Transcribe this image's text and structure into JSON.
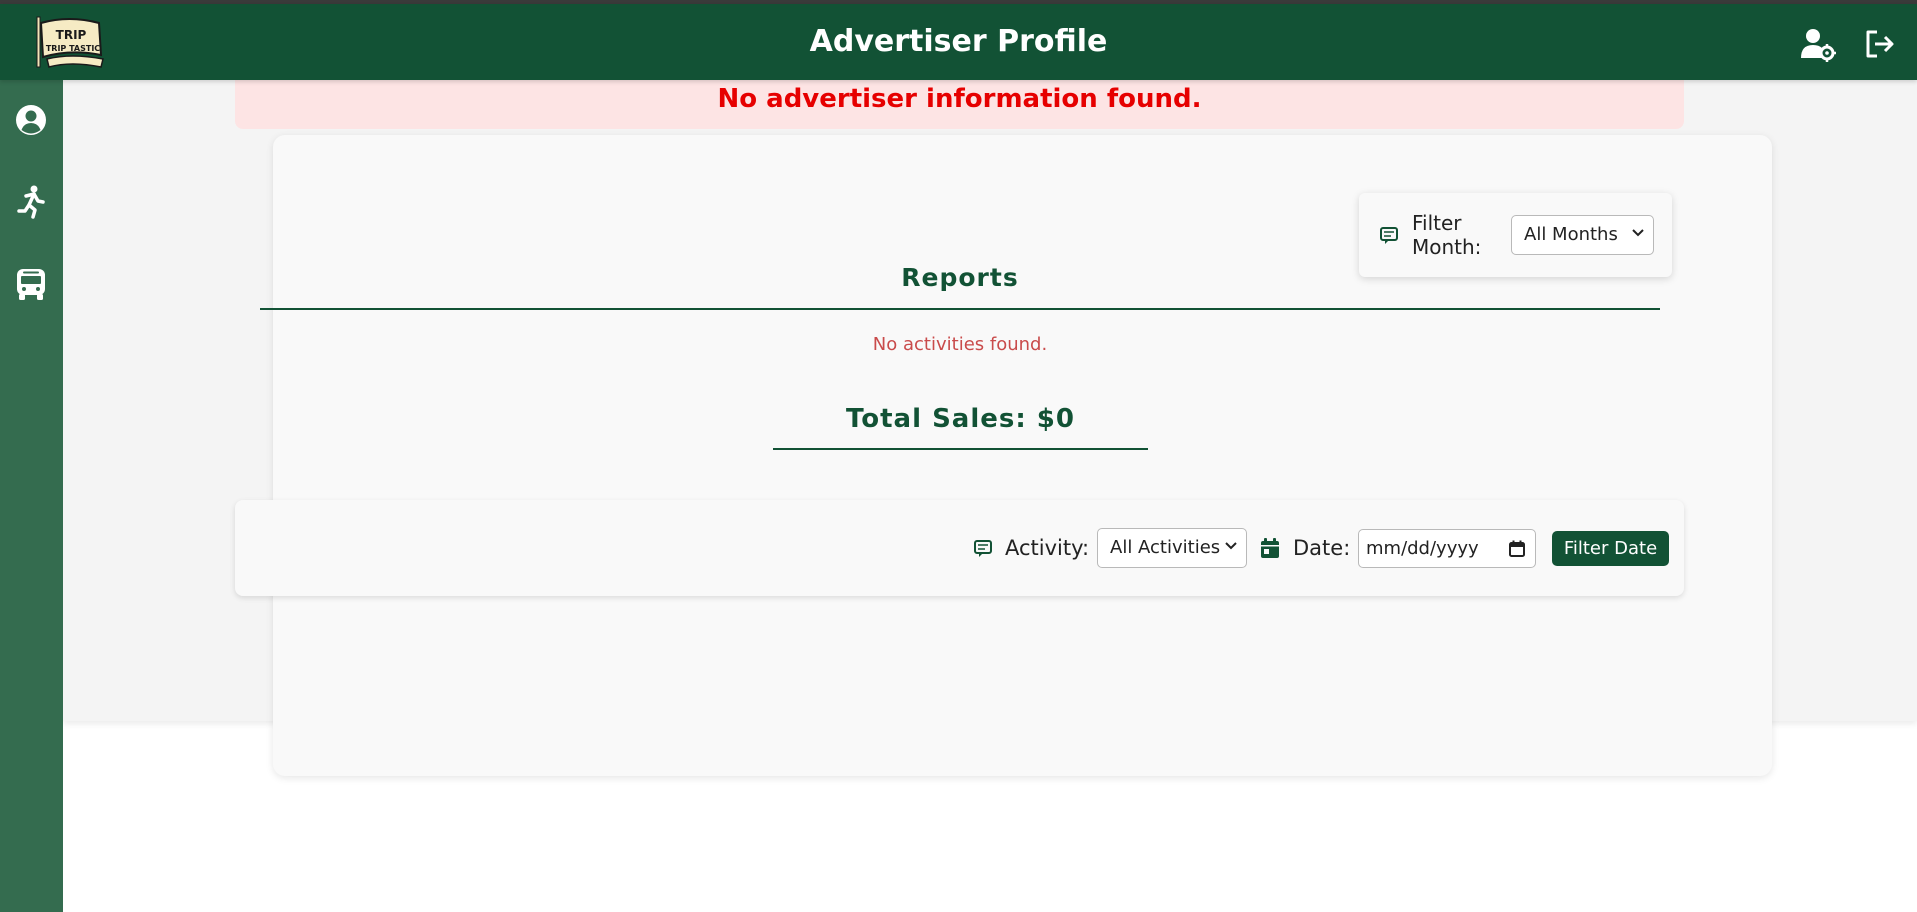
{
  "header": {
    "title": "Advertiser Profile",
    "logo_text_top": "TRIP",
    "logo_text_bottom": "TRIP TASTIC",
    "brand_color": "#125235"
  },
  "icons": {
    "header": [
      "user-settings-icon",
      "logout-icon"
    ],
    "sidebar": [
      "profile-icon",
      "activity-icon",
      "bus-icon"
    ]
  },
  "alert": {
    "message": "No advertiser information found.",
    "color": "#e60000"
  },
  "month_filter": {
    "label": "Filter Month:",
    "selected": "All Months"
  },
  "reports": {
    "title": "Reports",
    "empty_message": "No activities found.",
    "total_sales": "Total Sales: $0"
  },
  "filter_bar": {
    "activity_label": "Activity:",
    "activity_selected": "All Activities",
    "date_label": "Date:",
    "date_placeholder": "mm/dd/yyyy",
    "button_label": "Filter Date"
  }
}
